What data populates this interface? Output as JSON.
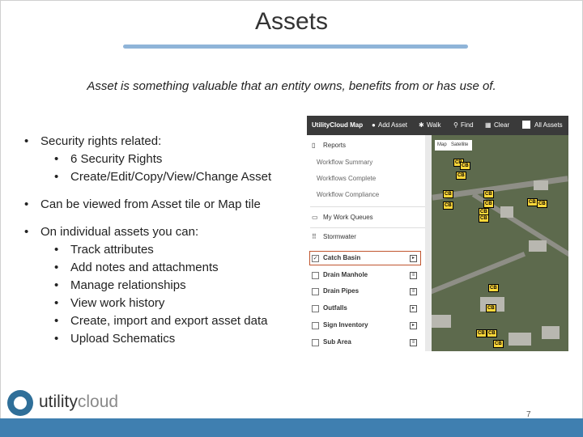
{
  "slide": {
    "title": "Assets",
    "subtitle": "Asset is something valuable that an entity owns, benefits from or has use of.",
    "page_number": "7"
  },
  "bullets": {
    "security": "Security rights related:",
    "security_sub1": "6 Security Rights",
    "security_sub2": "Create/Edit/Copy/View/Change Asset",
    "viewed": "Can be viewed from Asset tile or Map tile",
    "individual": "On individual assets you can:",
    "ind_sub1": "Track attributes",
    "ind_sub2": "Add notes and attachments",
    "ind_sub3": "Manage relationships",
    "ind_sub4": "View work history",
    "ind_sub5": "Create, import and export asset data",
    "ind_sub6": "Upload Schematics"
  },
  "app": {
    "title": "UtilityCloud Map",
    "toolbar": {
      "add_asset": "Add Asset",
      "walk": "Walk",
      "find": "Find",
      "clear": "Clear",
      "all_assets": "All Assets"
    },
    "panel": {
      "reports": "Reports",
      "workflow_summary": "Workflow Summary",
      "workflows_complete": "Workflows Complete",
      "workflow_compliance": "Workflow Compliance",
      "my_work_queues": "My Work Queues",
      "stormwater": "Stormwater",
      "layers": [
        {
          "label": "Catch Basin",
          "checked": true
        },
        {
          "label": "Drain Manhole",
          "checked": false
        },
        {
          "label": "Drain Pipes",
          "checked": false
        },
        {
          "label": "Outfalls",
          "checked": false
        },
        {
          "label": "Sign Inventory",
          "checked": false
        },
        {
          "label": "Sub Area",
          "checked": false
        }
      ]
    },
    "map": {
      "toggle_map": "Map",
      "toggle_satellite": "Satellite",
      "marker_label": "CB"
    },
    "colors": {
      "toolbar_bg": "#3a3a3a",
      "marker_fill": "#ffd83a",
      "highlight_border": "#c0552f"
    }
  },
  "logo": {
    "part1": "utility",
    "part2": "cloud"
  },
  "colors": {
    "title_bar": "#8fb4d8",
    "footer": "#3f7fb0"
  }
}
